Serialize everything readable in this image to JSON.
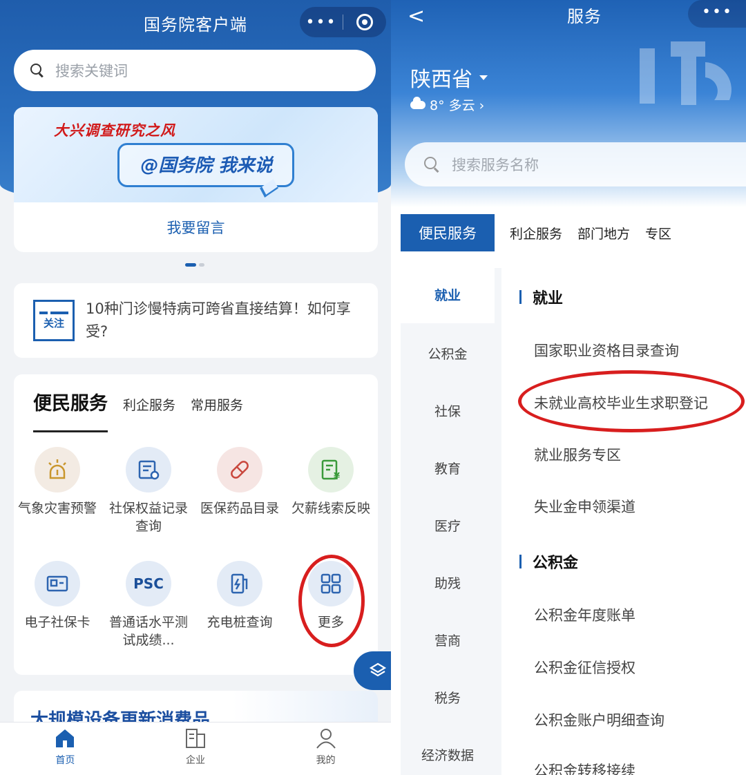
{
  "left": {
    "app_title": "国务院客户端",
    "search_placeholder": "搜索关键词",
    "banner": {
      "kicker": "大兴调查研究之风",
      "slogan": "@国务院 我来说",
      "action": "我要留言"
    },
    "notice": {
      "badge": "关注",
      "text": "10种门诊慢特病可跨省直接结算！如何享受?"
    },
    "service_tabs": [
      "便民服务",
      "利企服务",
      "常用服务"
    ],
    "services": [
      {
        "label": "气象灾害预警",
        "icon": "weather-alert-icon"
      },
      {
        "label": "社保权益记录查询",
        "icon": "social-security-record-icon"
      },
      {
        "label": "医保药品目录",
        "icon": "pill-icon"
      },
      {
        "label": "欠薪线索反映",
        "icon": "wage-report-icon"
      },
      {
        "label": "电子社保卡",
        "icon": "id-card-icon"
      },
      {
        "label": "普通话水平测试成绩...",
        "icon": "psc-icon",
        "icon_text": "PSC"
      },
      {
        "label": "充电桩查询",
        "icon": "charging-pile-icon"
      },
      {
        "label": "更多",
        "icon": "more-grid-icon"
      }
    ],
    "promo_title": "大规模设备更新消费品",
    "tabbar": [
      {
        "label": "首页",
        "icon": "home-icon",
        "active": true
      },
      {
        "label": "企业",
        "icon": "building-icon",
        "active": false
      },
      {
        "label": "我的",
        "icon": "user-icon",
        "active": false
      }
    ]
  },
  "right": {
    "page_title": "服务",
    "province": "陕西省",
    "weather": "8° 多云 ›",
    "search_placeholder": "搜索服务名称",
    "tabs": [
      "便民服务",
      "利企服务",
      "部门地方",
      "专区"
    ],
    "categories": [
      "就业",
      "公积金",
      "社保",
      "教育",
      "医疗",
      "助残",
      "营商",
      "税务",
      "经济数据"
    ],
    "sections": [
      {
        "title": "就业",
        "items": [
          "国家职业资格目录查询",
          "未就业高校毕业生求职登记",
          "就业服务专区",
          "失业金申领渠道"
        ]
      },
      {
        "title": "公积金",
        "items": [
          "公积金年度账单",
          "公积金征信授权",
          "公积金账户明细查询",
          "公积金转移接续"
        ]
      }
    ]
  },
  "colors": {
    "primary": "#1b5fb0",
    "header_blue": "#1f5dac",
    "highlight_red": "#d81e1e",
    "banner_red": "#d11a1a"
  }
}
